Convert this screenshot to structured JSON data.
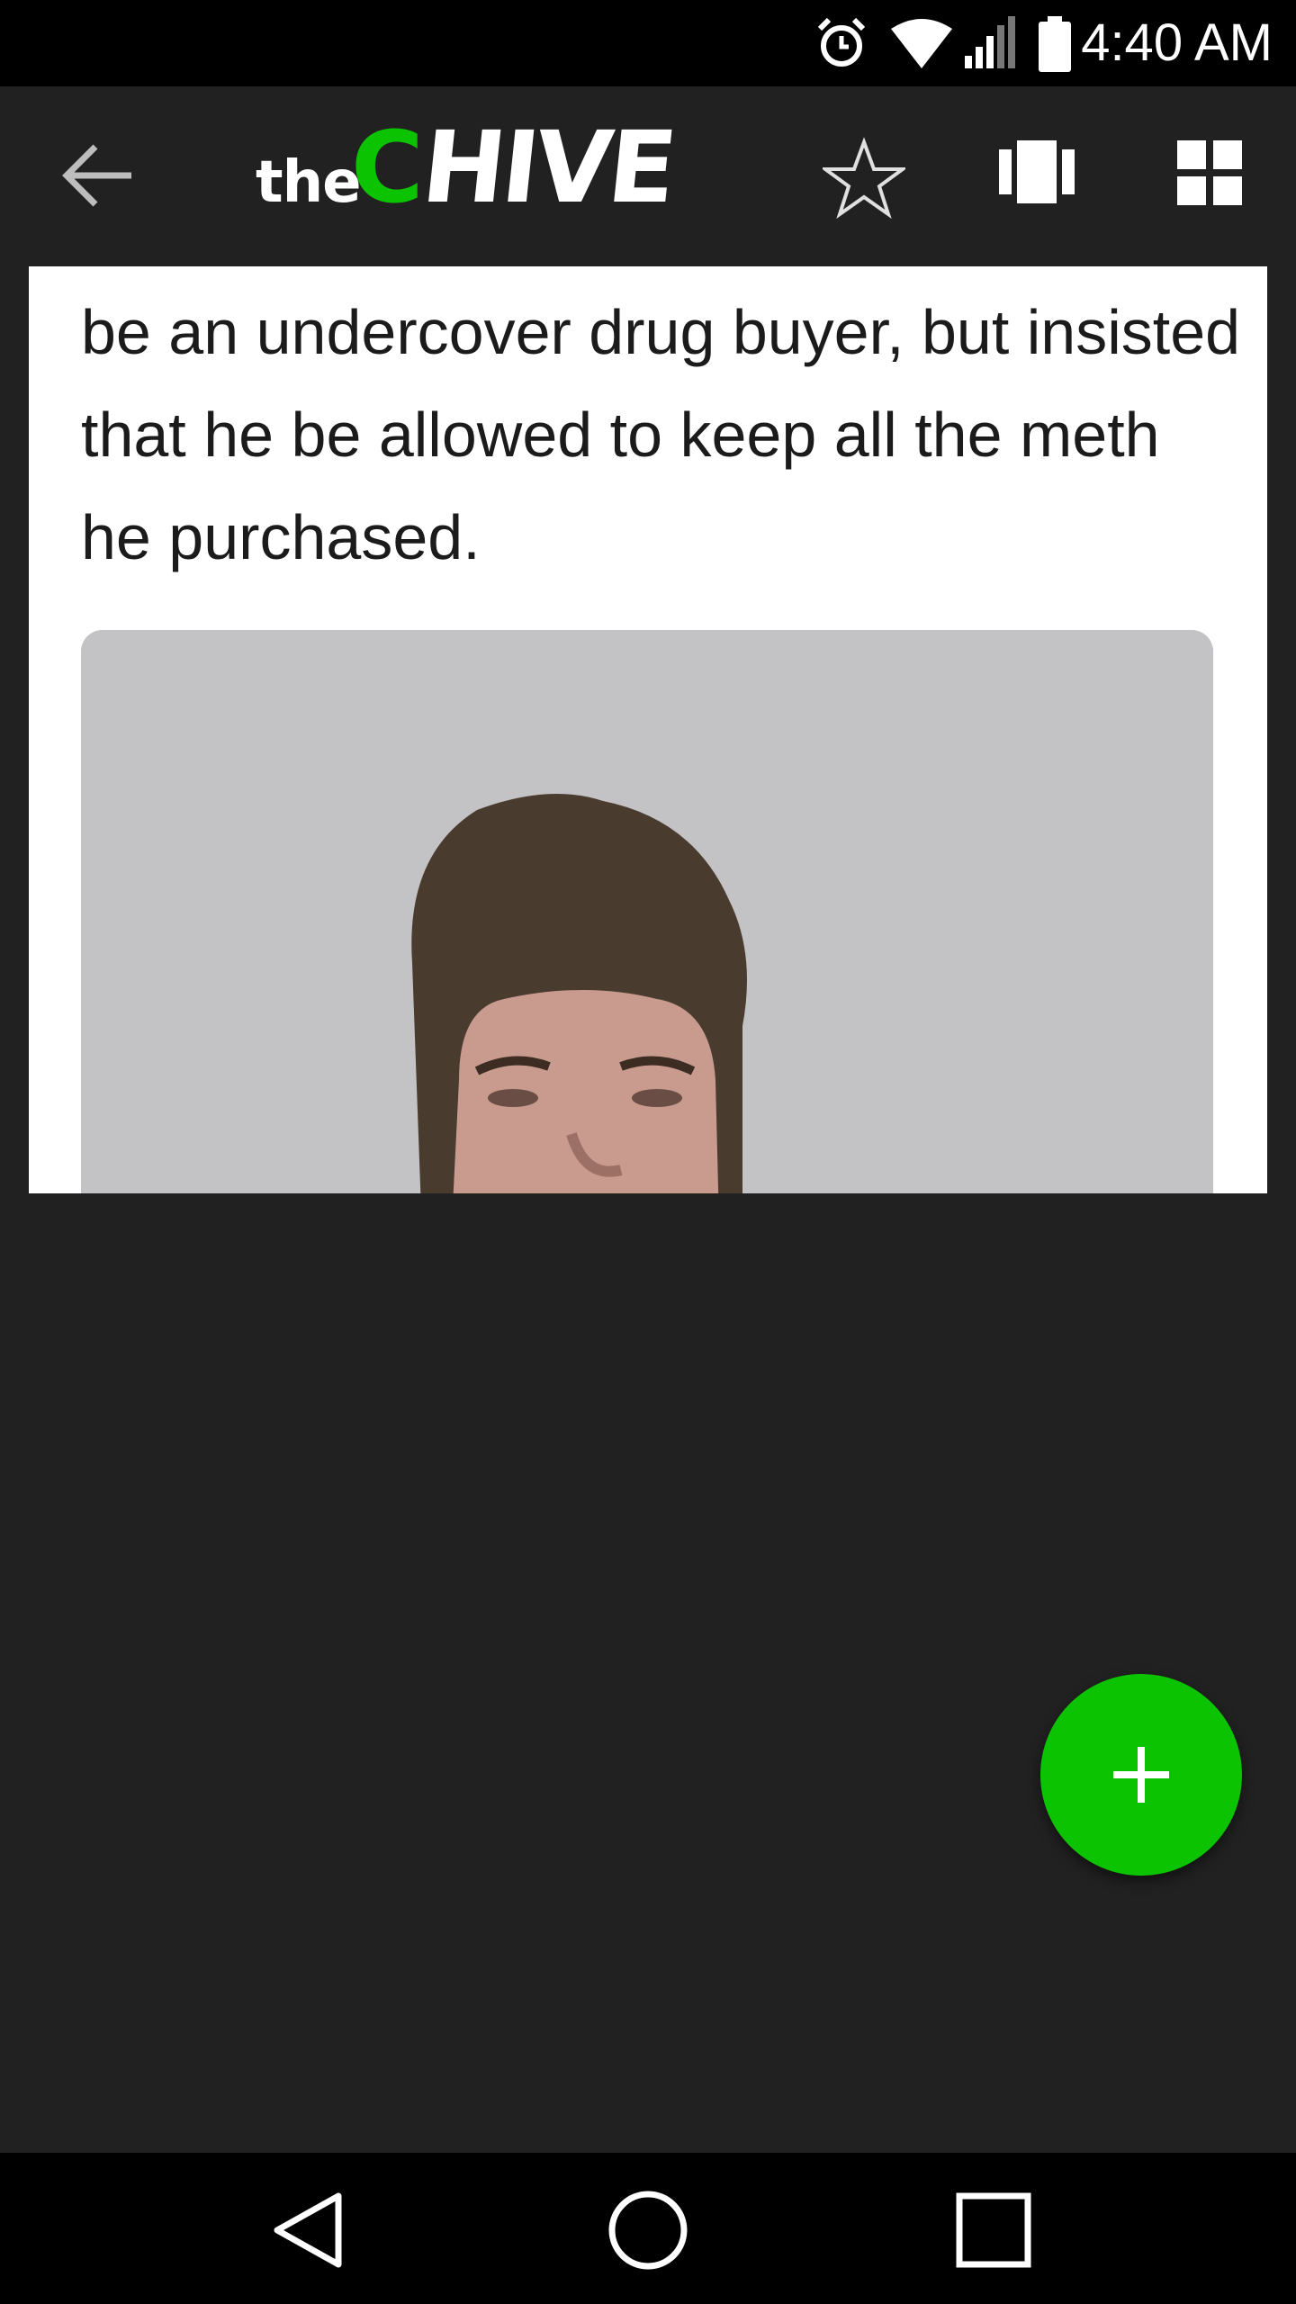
{
  "status_bar": {
    "time": "4:40 AM",
    "icons": [
      "alarm-icon",
      "wifi-icon",
      "signal-icon",
      "battery-icon"
    ]
  },
  "app_bar": {
    "logo": {
      "the": "the",
      "c": "C",
      "hive": "HIVE"
    },
    "icons": [
      "back-arrow-icon",
      "star-icon",
      "card-view-icon",
      "grid-view-icon"
    ],
    "accent_color": "#0bc300"
  },
  "post": {
    "caption": "be an undercover drug buyer, but insisted that he be allowed to keep all the meth he purchased.",
    "image": "mugshot-photo"
  },
  "fab": {
    "icon": "plus-icon",
    "color": "#0bc300"
  },
  "nav_bar": {
    "icons": [
      "nav-back-icon",
      "nav-home-icon",
      "nav-recents-icon"
    ]
  }
}
